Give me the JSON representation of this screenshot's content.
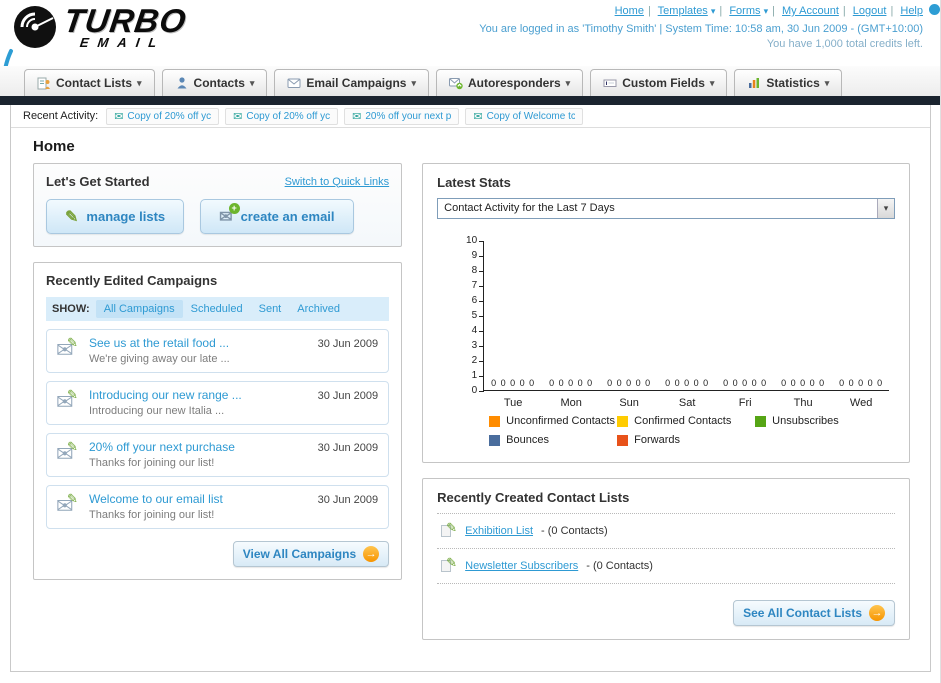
{
  "header": {
    "logo": {
      "line1": "TURBO",
      "line2": "EMAIL"
    },
    "top_links": [
      {
        "label": "Home",
        "dropdown": false
      },
      {
        "label": "Templates",
        "dropdown": true
      },
      {
        "label": "Forms",
        "dropdown": true
      },
      {
        "label": "My Account",
        "dropdown": false
      },
      {
        "label": "Logout",
        "dropdown": false
      },
      {
        "label": "Help",
        "dropdown": false
      }
    ],
    "login_info": "You are logged in as 'Timothy Smith' | System Time: 10:58 am, 30 Jun 2009 - (GMT+10:00)",
    "credits_info": "You have 1,000 total credits left."
  },
  "nav": {
    "tabs": [
      {
        "label": "Contact Lists"
      },
      {
        "label": "Contacts"
      },
      {
        "label": "Email Campaigns"
      },
      {
        "label": "Autoresponders"
      },
      {
        "label": "Custom Fields"
      },
      {
        "label": "Statistics"
      }
    ]
  },
  "recent_activity": {
    "label": "Recent Activity:",
    "items": [
      {
        "label": "Copy of 20% off yc"
      },
      {
        "label": "Copy of 20% off yc"
      },
      {
        "label": "20% off your next p"
      },
      {
        "label": "Copy of Welcome tc"
      }
    ]
  },
  "page": {
    "title": "Home"
  },
  "get_started": {
    "title": "Let's Get Started",
    "switch_link": "Switch to Quick Links",
    "manage_lists_label": "manage lists",
    "create_email_label": "create an email"
  },
  "campaigns": {
    "title": "Recently Edited Campaigns",
    "show_label": "SHOW:",
    "filters": [
      {
        "label": "All Campaigns",
        "active": true
      },
      {
        "label": "Scheduled",
        "active": false
      },
      {
        "label": "Sent",
        "active": false
      },
      {
        "label": "Archived",
        "active": false
      }
    ],
    "items": [
      {
        "title": "See us at the retail food ...",
        "subtitle": "We're giving away our late ...",
        "date": "30 Jun 2009"
      },
      {
        "title": "Introducing our new range ...",
        "subtitle": "Introducing our new Italia ...",
        "date": "30 Jun 2009"
      },
      {
        "title": "20% off your next purchase",
        "subtitle": "Thanks for joining our list!",
        "date": "30 Jun 2009"
      },
      {
        "title": "Welcome to our email list",
        "subtitle": "Thanks for joining our list!",
        "date": "30 Jun 2009"
      }
    ],
    "view_all_label": "View All Campaigns"
  },
  "latest_stats": {
    "title": "Latest Stats",
    "period_selected": "Contact Activity for the Last 7 Days"
  },
  "chart_data": {
    "type": "bar",
    "title": "Contact Activity for the Last 7 Days",
    "categories": [
      "Tue",
      "Mon",
      "Sun",
      "Sat",
      "Fri",
      "Thu",
      "Wed"
    ],
    "series": [
      {
        "name": "Unconfirmed Contacts",
        "color": "#ff8c00",
        "values": [
          0,
          0,
          0,
          0,
          0,
          0,
          0
        ]
      },
      {
        "name": "Confirmed Contacts",
        "color": "#ffcc00",
        "values": [
          0,
          0,
          0,
          0,
          0,
          0,
          0
        ]
      },
      {
        "name": "Unsubscribes",
        "color": "#56a515",
        "values": [
          0,
          0,
          0,
          0,
          0,
          0,
          0
        ]
      },
      {
        "name": "Bounces",
        "color": "#4a6d9d",
        "values": [
          0,
          0,
          0,
          0,
          0,
          0,
          0
        ]
      },
      {
        "name": "Forwards",
        "color": "#e8521a",
        "values": [
          0,
          0,
          0,
          0,
          0,
          0,
          0
        ]
      }
    ],
    "ylim": [
      0,
      10
    ],
    "ytick_step": 1,
    "grid": false,
    "legend_position": "bottom"
  },
  "contact_lists": {
    "title": "Recently Created Contact Lists",
    "items": [
      {
        "name": "Exhibition List",
        "suffix": "- (0 Contacts)"
      },
      {
        "name": "Newsletter Subscribers",
        "suffix": "- (0 Contacts)"
      }
    ],
    "see_all_label": "See All Contact Lists"
  },
  "icons": {
    "dropdown_arrow": "▾",
    "envelope": "✉",
    "pencil": "✎",
    "arrow_right": "→",
    "plus": "+",
    "separator": "|"
  },
  "colors": {
    "link": "#2e9ad3",
    "accent_orange": "#f7a400",
    "dark_bar": "#1b242f"
  }
}
